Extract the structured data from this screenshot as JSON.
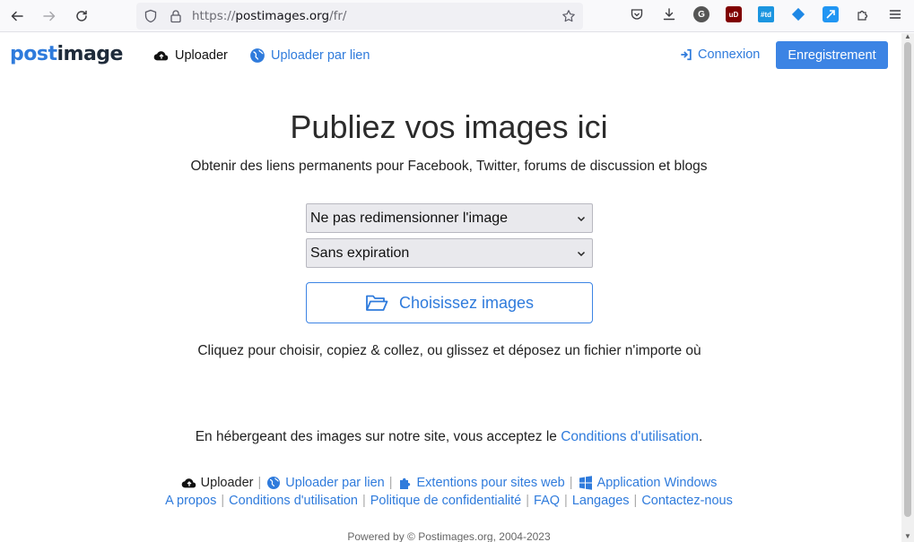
{
  "browser": {
    "url_scheme": "https://",
    "url_host": "postimages.org",
    "url_path": "/fr/",
    "extensions": {
      "g_label": "G",
      "ub_label": "uD",
      "td_label": "#td"
    }
  },
  "navbar": {
    "logo_post": "post",
    "logo_image": "image",
    "uploader_label": "Uploader",
    "uploader_link_label": "Uploader par lien",
    "login_label": "Connexion",
    "register_label": "Enregistrement"
  },
  "main": {
    "title": "Publiez vos images ici",
    "subtitle": "Obtenir des liens permanents pour Facebook, Twitter, forums de discussion et blogs",
    "resize_select": "Ne pas redimensionner l'image",
    "expiration_select": "Sans expiration",
    "choose_button": "Choisissez images",
    "help_text": "Cliquez pour choisir, copiez & collez, ou glissez et déposez un fichier n'importe où",
    "terms_prefix": "En hébergeant des images sur notre site, vous acceptez le ",
    "terms_link": "Conditions d'utilisation",
    "terms_suffix": "."
  },
  "footer": {
    "row1": {
      "uploader": "Uploader",
      "uploader_link": "Uploader par lien",
      "extensions": "Extentions pour sites web",
      "windows_app": "Application Windows"
    },
    "row2": {
      "about": "A propos",
      "terms": "Conditions d'utilisation",
      "privacy": "Politique de confidentialité",
      "faq": "FAQ",
      "languages": "Langages",
      "contact": "Contactez-nous"
    },
    "powered": "Powered by © Postimages.org, 2004-2023"
  },
  "colors": {
    "accent": "#2f7bdc",
    "primary_button": "#3c84e4",
    "text": "#212529"
  }
}
